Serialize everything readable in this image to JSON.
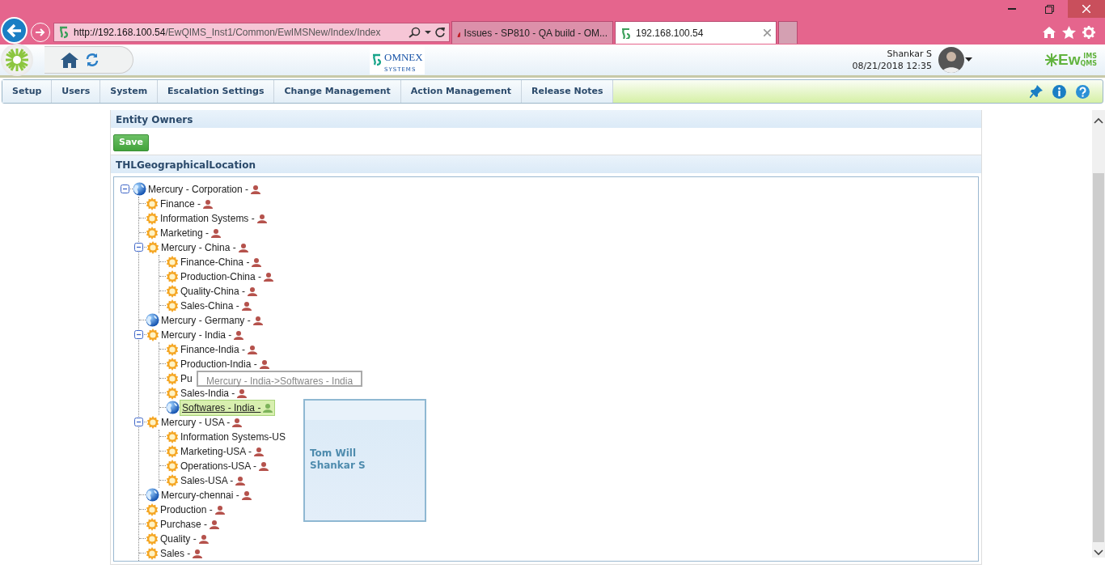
{
  "browser": {
    "url_host": "http://192.168.100.54",
    "url_path": "/EwQIMS_Inst1/Common/EwIMSNew/Index/Index",
    "tabs": [
      {
        "title": "Issues - SP810 - QA build - OM...",
        "selected": false
      },
      {
        "title": "192.168.100.54",
        "selected": true
      }
    ]
  },
  "header": {
    "omnex_logo": {
      "name": "OMNEX",
      "tagline": "SYSTEMS"
    },
    "user": "Shankar S",
    "datetime": "08/21/2018 12:35",
    "product_logo": {
      "main": "Ew",
      "top": "IMS",
      "bottom": "QMS"
    }
  },
  "menu": [
    "Setup",
    "Users",
    "System",
    "Escalation Settings",
    "Change Management",
    "Action Management",
    "Release Notes"
  ],
  "panel": {
    "title": "Entity Owners",
    "save": "Save",
    "section": "THLGeographicalLocation"
  },
  "tree": [
    {
      "label": "Mercury - Corporation -",
      "kind": "globe",
      "expanded": true,
      "selected": false,
      "children": [
        {
          "label": "Finance -",
          "kind": "gear",
          "selected": false
        },
        {
          "label": "Information Systems -",
          "kind": "gear",
          "selected": false
        },
        {
          "label": "Marketing -",
          "kind": "gear",
          "selected": false
        },
        {
          "label": "Mercury - China -",
          "kind": "gear",
          "expanded": true,
          "selected": false,
          "children": [
            {
              "label": "Finance-China -",
              "kind": "gear",
              "selected": false
            },
            {
              "label": "Production-China -",
              "kind": "gear",
              "selected": false
            },
            {
              "label": "Quality-China -",
              "kind": "gear",
              "selected": false
            },
            {
              "label": "Sales-China -",
              "kind": "gear",
              "selected": false
            }
          ]
        },
        {
          "label": "Mercury - Germany -",
          "kind": "globe",
          "selected": false
        },
        {
          "label": "Mercury - India -",
          "kind": "gear",
          "expanded": true,
          "selected": false,
          "children": [
            {
              "label": "Finance-India -",
              "kind": "gear",
              "selected": false
            },
            {
              "label": "Production-India -",
              "kind": "gear",
              "selected": false
            },
            {
              "label": "Pu",
              "kind": "gear",
              "selected": false,
              "owner": false,
              "tooltip": "Mercury - India->Softwares - India"
            },
            {
              "label": "Sales-India -",
              "kind": "gear",
              "selected": false
            },
            {
              "label": "Softwares - India -",
              "kind": "globe",
              "selected": true
            }
          ]
        },
        {
          "label": "Mercury - USA -",
          "kind": "gear",
          "expanded": true,
          "selected": false,
          "children": [
            {
              "label": "Information Systems-US",
              "kind": "gear",
              "selected": false,
              "owner": false
            },
            {
              "label": "Marketing-USA -",
              "kind": "gear",
              "selected": false
            },
            {
              "label": "Operations-USA -",
              "kind": "gear",
              "selected": false
            },
            {
              "label": "Sales-USA -",
              "kind": "gear",
              "selected": false
            }
          ]
        },
        {
          "label": "Mercury-chennai -",
          "kind": "globe",
          "selected": false
        },
        {
          "label": "Production -",
          "kind": "gear",
          "selected": false
        },
        {
          "label": "Purchase -",
          "kind": "gear",
          "selected": false
        },
        {
          "label": "Quality -",
          "kind": "gear",
          "selected": false
        },
        {
          "label": "Sales -",
          "kind": "gear",
          "selected": false
        }
      ]
    }
  ],
  "owners_popup": [
    "Tom Will",
    "Shankar S"
  ]
}
